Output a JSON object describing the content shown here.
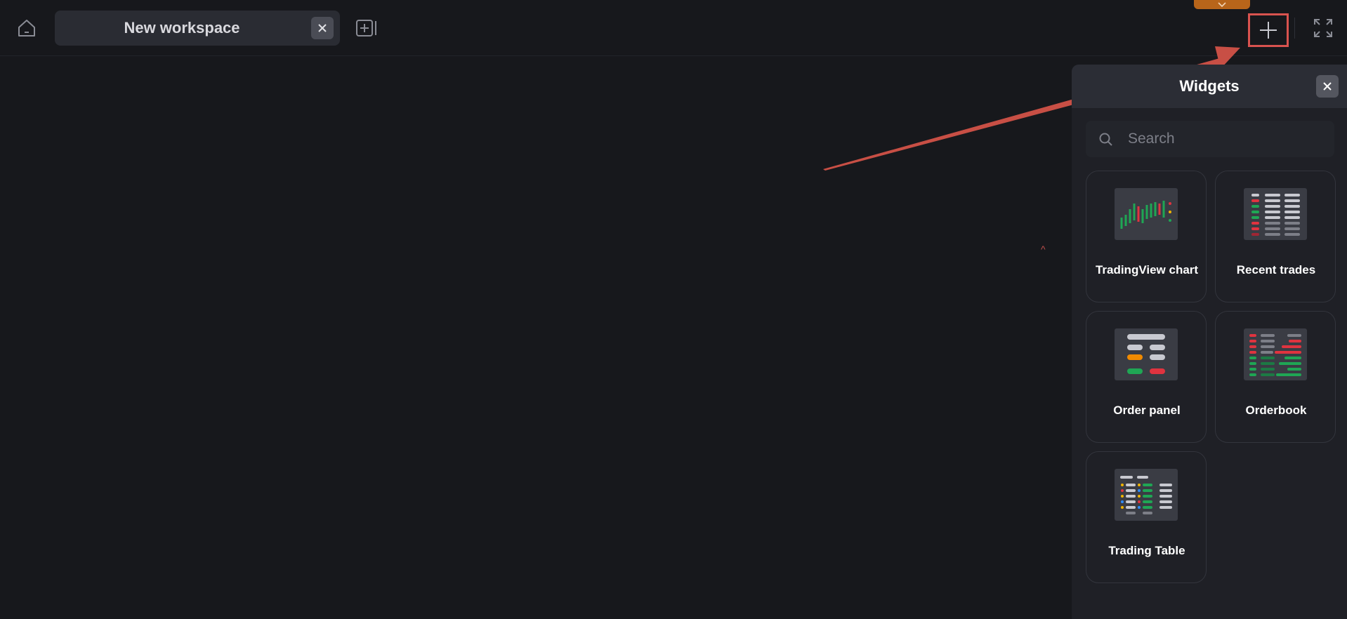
{
  "topbar": {
    "tab_title": "New workspace",
    "home_icon": "home-icon",
    "tab_close_icon": "close-icon",
    "add_tab_icon": "add-tab-icon",
    "add_widget_icon": "plus-icon",
    "fullscreen_icon": "fullscreen-icon",
    "collapse_icon": "chevron-down-icon",
    "accent_color": "#b8651a"
  },
  "annotation": {
    "highlight_color": "#d9534f",
    "caret": "^"
  },
  "widgets_panel": {
    "title": "Widgets",
    "close_icon": "close-icon",
    "search": {
      "placeholder": "Search",
      "value": ""
    },
    "items": [
      {
        "label": "TradingView chart",
        "thumb": "candlestick-chart"
      },
      {
        "label": "Recent trades",
        "thumb": "trades-list"
      },
      {
        "label": "Order panel",
        "thumb": "order-form"
      },
      {
        "label": "Orderbook",
        "thumb": "orderbook-depth"
      },
      {
        "label": "Trading Table",
        "thumb": "trading-table"
      }
    ]
  },
  "colors": {
    "background": "#17181c",
    "panel": "#1f2026",
    "buy": "#1fa654",
    "sell": "#e0333f",
    "neutral": "#c8c9d0",
    "warning": "#f08a00"
  }
}
